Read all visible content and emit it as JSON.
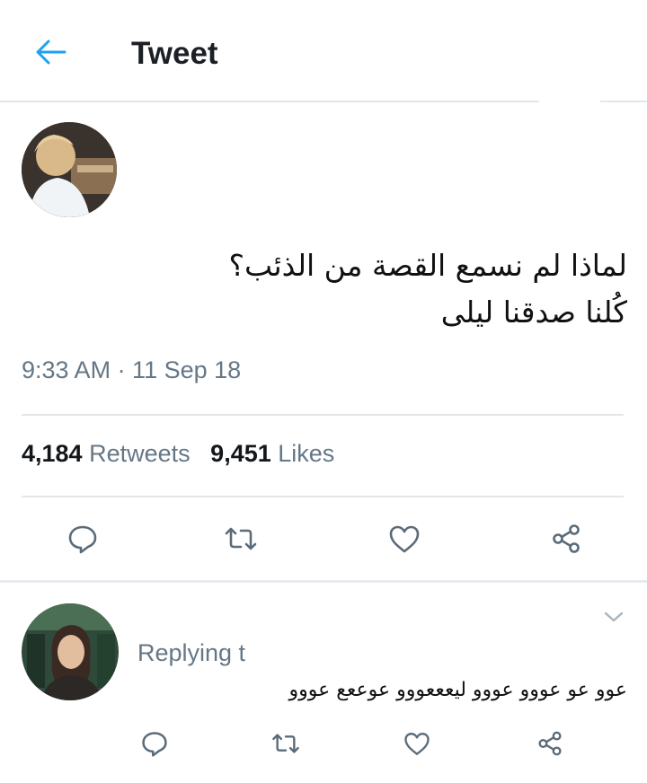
{
  "header": {
    "title": "Tweet",
    "back_icon": "arrow-left-icon",
    "accent": "#1da1f2"
  },
  "tweet": {
    "text_line1": "لماذا لم نسمع القصة من الذئب؟",
    "text_line2": "كُلنا صدقنا ليلى",
    "timestamp": "9:33 AM · 11 Sep 18",
    "retweets_count": "4,184",
    "retweets_label": "Retweets",
    "likes_count": "9,451",
    "likes_label": "Likes",
    "actions": [
      "comment-icon",
      "retweet-icon",
      "heart-icon",
      "share-icon"
    ]
  },
  "reply": {
    "replying_to": "Replying t",
    "text": "عوو عو عووو عووو ليعععووو عوععع عووو",
    "actions": [
      "comment-icon",
      "retweet-icon",
      "heart-icon",
      "share-icon"
    ]
  },
  "colors": {
    "muted": "#657786",
    "divider": "#e3e6ea",
    "icon": "#5b6b78"
  }
}
